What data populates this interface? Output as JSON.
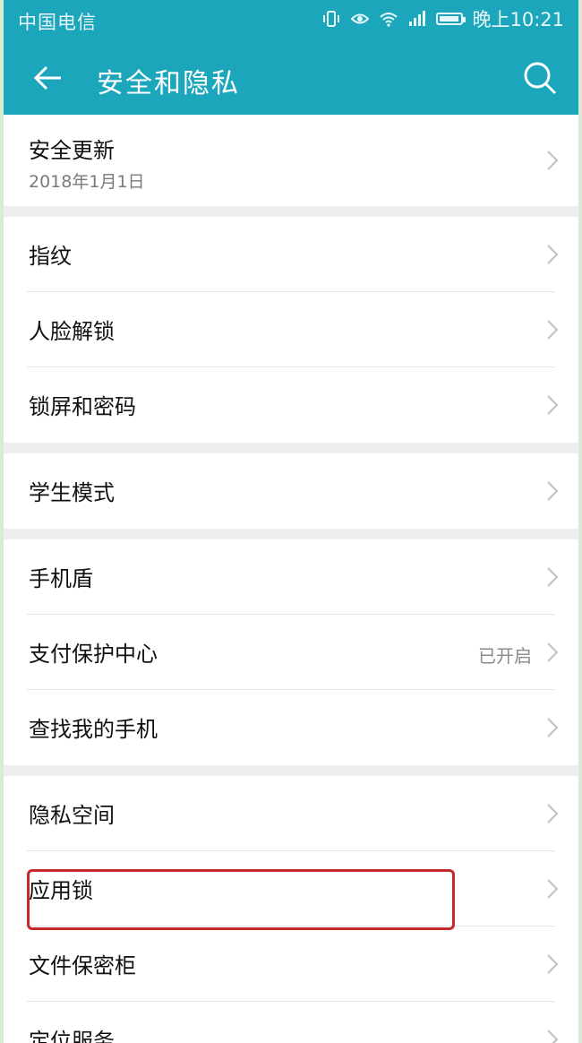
{
  "status_bar": {
    "carrier": "中国电信",
    "time": "晚上10:21",
    "icons": [
      "vibrate-icon",
      "eye-icon",
      "wifi-icon",
      "signal-icon",
      "battery-icon"
    ]
  },
  "header": {
    "title": "安全和隐私",
    "back_icon": "arrow-left-icon",
    "search_icon": "search-icon",
    "background": "#1ba6bb"
  },
  "settings": {
    "security_update": {
      "label": "安全更新",
      "date": "2018年1月1日"
    },
    "fingerprint": {
      "label": "指纹"
    },
    "face_unlock": {
      "label": "人脸解锁"
    },
    "lock_screen": {
      "label": "锁屏和密码"
    },
    "student_mode": {
      "label": "学生模式"
    },
    "phone_shield": {
      "label": "手机盾"
    },
    "payment_protection": {
      "label": "支付保护中心",
      "value": "已开启"
    },
    "find_my_phone": {
      "label": "查找我的手机"
    },
    "private_space": {
      "label": "隐私空间"
    },
    "app_lock": {
      "label": "应用锁",
      "highlighted": true,
      "highlight_color": "#c22a2a"
    },
    "file_safe": {
      "label": "文件保密柜"
    },
    "location_services": {
      "label": "定位服务"
    }
  }
}
